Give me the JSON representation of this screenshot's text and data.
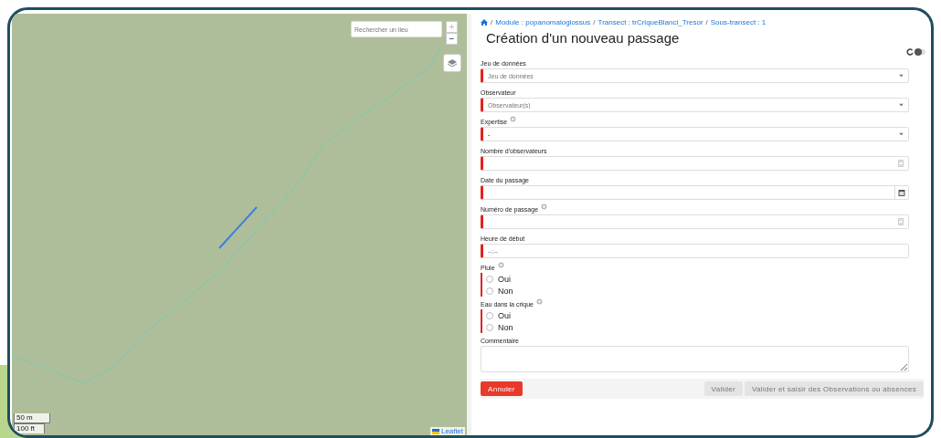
{
  "map": {
    "search": {
      "placeholder": "Rechercher un lieu"
    },
    "zoom_in": "+",
    "zoom_out": "−",
    "scale": [
      "50 m",
      "100 ft"
    ],
    "attribution": "Leaflet"
  },
  "breadcrumb_separator": "/",
  "breadcrumb": [
    "Module : popanomaloglossus",
    "Transect : trCriqueBlanci_Tresor",
    "Sous-transect : 1"
  ],
  "title": "Création d'un nouveau passage",
  "toggle": {
    "on": false
  },
  "fields": [
    {
      "kind": "select",
      "label": "Jeu de données",
      "help": false,
      "required": true,
      "placeholder": "Jeu de données"
    },
    {
      "kind": "select",
      "label": "Observateur",
      "help": false,
      "required": true,
      "placeholder": "Observateur(s)"
    },
    {
      "kind": "select",
      "label": "Expertise",
      "help": true,
      "required": true,
      "value": "-"
    },
    {
      "kind": "number",
      "label": "Nombre d'observateurs",
      "help": false,
      "required": true
    },
    {
      "kind": "date",
      "label": "Date du passage",
      "help": false,
      "required": true
    },
    {
      "kind": "number",
      "label": "Numéro de passage",
      "help": true,
      "required": true
    },
    {
      "kind": "time",
      "label": "Heure de début",
      "help": false,
      "required": true,
      "placeholder": "--:--"
    },
    {
      "kind": "radio",
      "label": "Pluie",
      "help": true,
      "required": true,
      "options": [
        {
          "label": "Oui",
          "selected": false
        },
        {
          "label": "Non",
          "selected": false
        }
      ]
    },
    {
      "kind": "radio",
      "label": "Eau dans la crique",
      "help": true,
      "required": true,
      "options": [
        {
          "label": "Oui",
          "selected": false
        },
        {
          "label": "Non",
          "selected": false
        }
      ]
    },
    {
      "kind": "textarea",
      "label": "Commentaire",
      "help": false,
      "required": false
    }
  ],
  "buttons": [
    {
      "label": "Annuler",
      "kind": "danger",
      "disabled": false
    },
    {
      "label": "Valider",
      "kind": "secondary",
      "disabled": true
    },
    {
      "label": "Valider et saisir des Observations ou absences",
      "kind": "secondary",
      "disabled": true
    }
  ]
}
